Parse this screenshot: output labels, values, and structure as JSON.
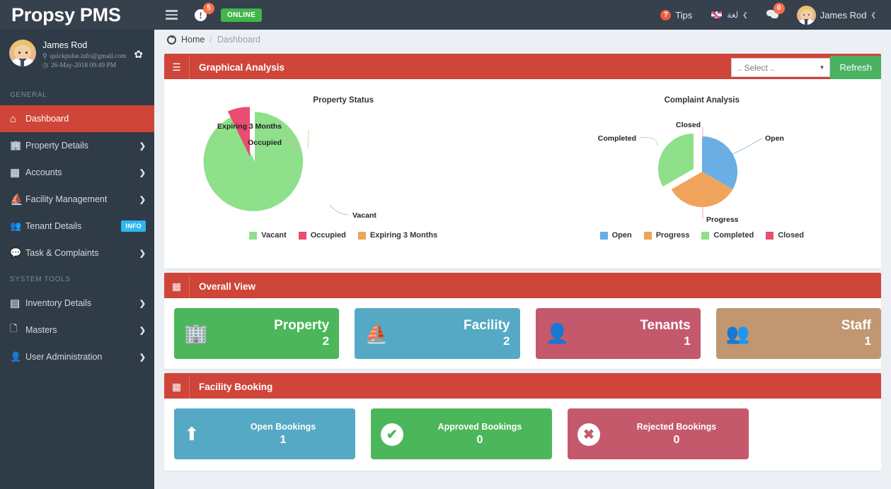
{
  "app": {
    "brand": "Propsy PMS",
    "online_badge": "ONLINE",
    "alert_count": "5",
    "message_count": "0"
  },
  "topbar": {
    "tips_label": "Tips",
    "tips_icon_glyph": "?",
    "warn_icon_glyph": "!",
    "language_label": "لغة",
    "user_name": "James Rod",
    "caret": "❮"
  },
  "sidebar": {
    "user": {
      "name": "James Rod",
      "email": "quickpulse.info@gmail.com",
      "timestamp": "26-May-2018 09:49 PM"
    },
    "sections": [
      {
        "title": "GENERAL",
        "items": [
          {
            "label": "Dashboard",
            "icon": "home-icon",
            "glyph": "⌂",
            "active": true,
            "chevron": false,
            "badge": null
          },
          {
            "label": "Property Details",
            "icon": "building-icon",
            "glyph": "🏢",
            "active": false,
            "chevron": true,
            "badge": null
          },
          {
            "label": "Accounts",
            "icon": "calculator-icon",
            "glyph": "▦",
            "active": false,
            "chevron": true,
            "badge": null
          },
          {
            "label": "Facility Management",
            "icon": "boat-icon",
            "glyph": "⛵",
            "active": false,
            "chevron": true,
            "badge": null
          },
          {
            "label": "Tenant Details",
            "icon": "users-icon",
            "glyph": "👥",
            "active": false,
            "chevron": false,
            "badge": "INFO"
          },
          {
            "label": "Task & Complaints",
            "icon": "comments-icon",
            "glyph": "💬",
            "active": false,
            "chevron": true,
            "badge": null
          }
        ]
      },
      {
        "title": "SYSTEM TOOLS",
        "items": [
          {
            "label": "Inventory Details",
            "icon": "layers-icon",
            "glyph": "▤",
            "active": false,
            "chevron": true,
            "badge": null
          },
          {
            "label": "Masters",
            "icon": "file-icon",
            "glyph": "🗋",
            "active": false,
            "chevron": true,
            "badge": null
          },
          {
            "label": "User Administration",
            "icon": "user-icon",
            "glyph": "👤",
            "active": false,
            "chevron": true,
            "badge": null
          }
        ]
      }
    ]
  },
  "breadcrumb": {
    "home": "Home",
    "separator": "/",
    "current": "Dashboard"
  },
  "panels": {
    "graphical_analysis": {
      "title": "Graphical Analysis",
      "select_value": ".. Select ..",
      "refresh_label": "Refresh"
    },
    "overall_view": {
      "title": "Overall View"
    },
    "facility_booking": {
      "title": "Facility Booking"
    }
  },
  "overall_cards": [
    {
      "title": "Property",
      "value": "2",
      "color": "#4cb75a",
      "icon": "buildings-icon",
      "glyph": "🏢"
    },
    {
      "title": "Facility",
      "value": "2",
      "color": "#55a9c4",
      "icon": "boat-icon",
      "glyph": "⛵"
    },
    {
      "title": "Tenants",
      "value": "1",
      "color": "#c4596c",
      "icon": "tenant-icon",
      "glyph": "👤"
    },
    {
      "title": "Staff",
      "value": "1",
      "color": "#c09771",
      "icon": "staff-icon",
      "glyph": "👥"
    }
  ],
  "booking_cards": [
    {
      "title": "Open Bookings",
      "value": "1",
      "color": "#55a9c4",
      "icon": "upload-icon",
      "glyph": "⬆"
    },
    {
      "title": "Approved Bookings",
      "value": "0",
      "color": "#4cb75a",
      "icon": "check-icon",
      "glyph": "✔"
    },
    {
      "title": "Rejected Bookings",
      "value": "0",
      "color": "#c4596c",
      "icon": "cross-icon",
      "glyph": "✖"
    }
  ],
  "chart_data": [
    {
      "type": "pie",
      "title": "Property Status",
      "categories": [
        "Vacant",
        "Occupied",
        "Expiring 3 Months"
      ],
      "values": [
        87,
        13,
        0
      ],
      "colors": [
        "#8ee08a",
        "#ea4c72",
        "#f0a35a"
      ],
      "exploded": [
        "Occupied"
      ],
      "labels_shown": [
        "Expiring 3 Months",
        "Occupied",
        "Vacant"
      ],
      "legend": [
        "Vacant",
        "Occupied",
        "Expiring 3 Months"
      ],
      "legend_position": "bottom"
    },
    {
      "type": "pie",
      "title": "Complaint Analysis",
      "categories": [
        "Open",
        "Progress",
        "Completed",
        "Closed"
      ],
      "values": [
        33.3,
        33.3,
        33.3,
        0
      ],
      "colors": [
        "#6aaee4",
        "#f0a35a",
        "#8ee08a",
        "#ea4c72"
      ],
      "exploded": [
        "Completed"
      ],
      "labels_shown": [
        "Closed",
        "Completed",
        "Open",
        "Progress"
      ],
      "legend": [
        "Open",
        "Progress",
        "Completed",
        "Closed"
      ],
      "legend_position": "bottom"
    }
  ]
}
